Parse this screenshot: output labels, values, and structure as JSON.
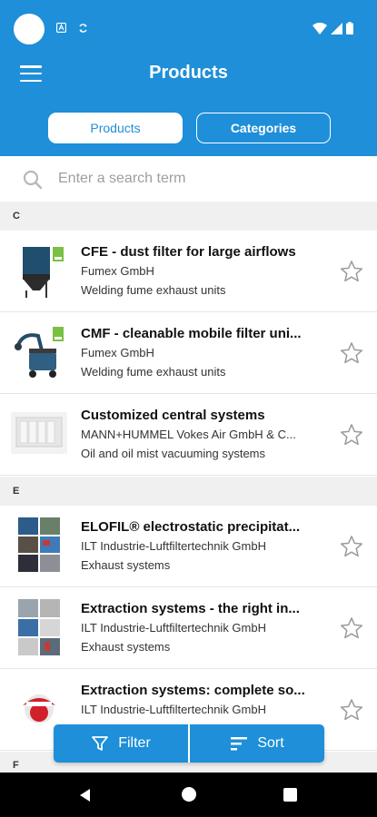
{
  "header": {
    "title": "Products",
    "tabs": [
      {
        "label": "Products",
        "active": true
      },
      {
        "label": "Categories",
        "active": false
      }
    ]
  },
  "search": {
    "placeholder": "Enter a search term"
  },
  "sections": [
    {
      "letter": "C",
      "items": [
        {
          "title": "CFE - dust filter for large airflows",
          "company": "Fumex GmbH",
          "category": "Welding fume exhaust units",
          "thumb": "filter-unit-dark"
        },
        {
          "title": "CMF - cleanable mobile filter uni...",
          "company": "Fumex GmbH",
          "category": "Welding fume exhaust units",
          "thumb": "mobile-filter-arm"
        },
        {
          "title": "Customized central systems",
          "company": "MANN+HUMMEL Vokes Air GmbH & C...",
          "category": "Oil and oil mist vacuuming systems",
          "thumb": "central-system-light"
        }
      ]
    },
    {
      "letter": "E",
      "items": [
        {
          "title": "ELOFIL® electrostatic precipitat...",
          "company": "ILT Industrie-Luftfiltertechnik GmbH",
          "category": "Exhaust systems",
          "thumb": "collage"
        },
        {
          "title": "Extraction systems - the right in...",
          "company": "ILT Industrie-Luftfiltertechnik GmbH",
          "category": "Exhaust systems",
          "thumb": "collage-2"
        },
        {
          "title": "Extraction systems: complete so...",
          "company": "ILT Industrie-Luftfiltertechnik GmbH",
          "category": "",
          "thumb": "logo-red"
        }
      ]
    },
    {
      "letter": "F",
      "items": []
    }
  ],
  "actions": {
    "filter_label": "Filter",
    "sort_label": "Sort"
  },
  "colors": {
    "accent": "#1e8fd8",
    "section_bg": "#f0f0f0"
  },
  "status_icons": [
    "wifi-icon",
    "signal-icon",
    "battery-icon"
  ]
}
